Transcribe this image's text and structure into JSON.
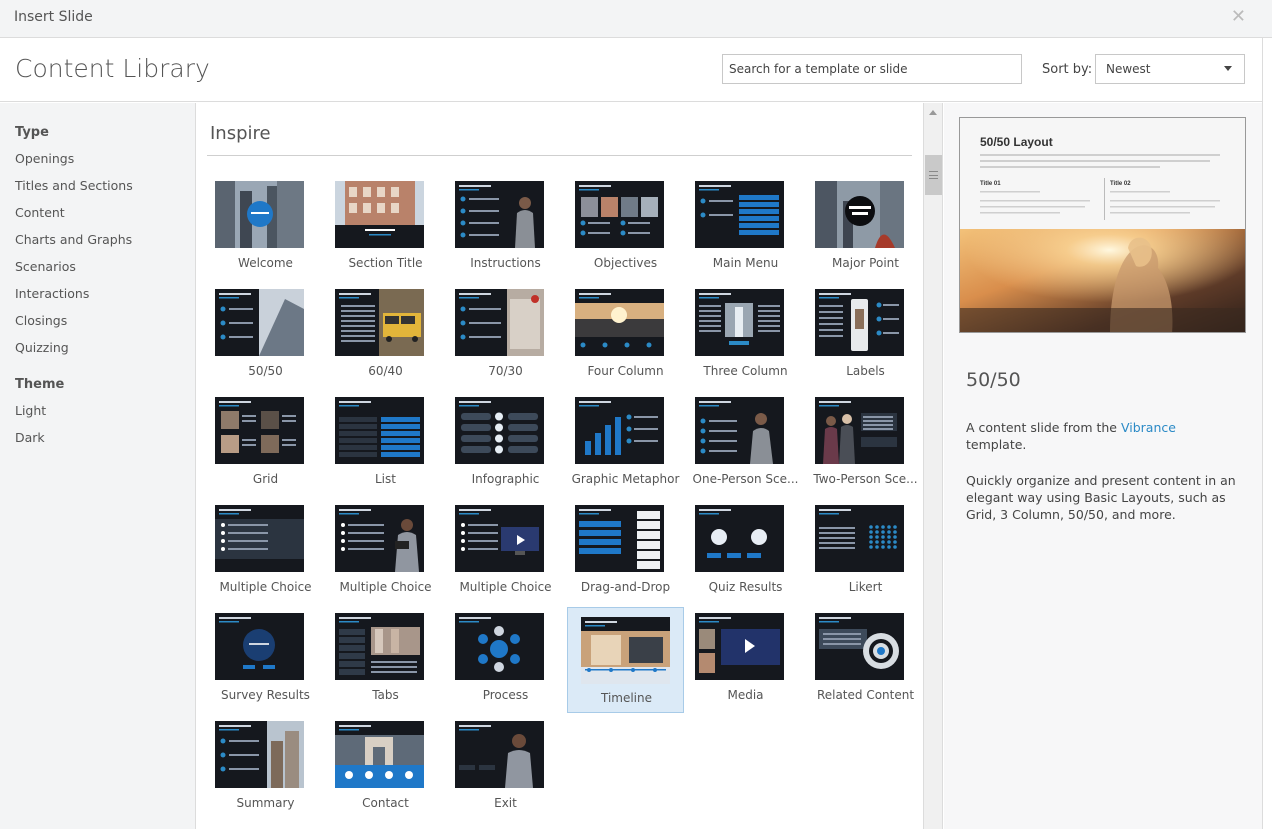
{
  "window": {
    "title": "Insert Slide"
  },
  "header": {
    "title": "Content Library",
    "search_placeholder": "Search for a template or slide",
    "sort_label": "Sort by:",
    "sort_value": "Newest"
  },
  "sidebar": {
    "type_heading": "Type",
    "types": [
      "Openings",
      "Titles and Sections",
      "Content",
      "Charts and Graphs",
      "Scenarios",
      "Interactions",
      "Closings",
      "Quizzing"
    ],
    "theme_heading": "Theme",
    "themes": [
      "Light",
      "Dark"
    ]
  },
  "main": {
    "section_title": "Inspire",
    "tiles": [
      {
        "label": "Welcome",
        "img": "welcome"
      },
      {
        "label": "Section Title",
        "img": "section"
      },
      {
        "label": "Instructions",
        "img": "instructions"
      },
      {
        "label": "Objectives",
        "img": "objectives"
      },
      {
        "label": "Main Menu",
        "img": "menu"
      },
      {
        "label": "Major Point",
        "img": "major"
      },
      {
        "label": "50/50",
        "img": "fifty"
      },
      {
        "label": "60/40",
        "img": "sixty"
      },
      {
        "label": "70/30",
        "img": "seventy"
      },
      {
        "label": "Four Column",
        "img": "four"
      },
      {
        "label": "Three Column",
        "img": "three"
      },
      {
        "label": "Labels",
        "img": "labels"
      },
      {
        "label": "Grid",
        "img": "grid"
      },
      {
        "label": "List",
        "img": "list"
      },
      {
        "label": "Infographic",
        "img": "info"
      },
      {
        "label": "Graphic Metaphor",
        "img": "metaphor"
      },
      {
        "label": "One-Person  Sce...",
        "img": "oneperson"
      },
      {
        "label": "Two-Person  Sce...",
        "img": "twoperson"
      },
      {
        "label": "Multiple Choice",
        "img": "mc1"
      },
      {
        "label": "Multiple Choice",
        "img": "mc2"
      },
      {
        "label": "Multiple Choice",
        "img": "mc3"
      },
      {
        "label": "Drag-and-Drop",
        "img": "drag"
      },
      {
        "label": "Quiz Results",
        "img": "quiz"
      },
      {
        "label": "Likert",
        "img": "likert"
      },
      {
        "label": "Survey Results",
        "img": "survey"
      },
      {
        "label": "Tabs",
        "img": "tabs"
      },
      {
        "label": "Process",
        "img": "process"
      },
      {
        "label": "Timeline",
        "img": "timeline",
        "selected": true
      },
      {
        "label": "Media",
        "img": "media"
      },
      {
        "label": "Related Content",
        "img": "related"
      },
      {
        "label": "Summary",
        "img": "summary"
      },
      {
        "label": "Contact",
        "img": "contact"
      },
      {
        "label": "Exit",
        "img": "exit"
      }
    ]
  },
  "preview": {
    "slide_title": "50/50 Layout",
    "slide_col1": "Title 01",
    "slide_col2": "Title 02",
    "name": "50/50",
    "desc_prefix": "A content slide from the ",
    "desc_link": "Vibrance",
    "desc_suffix": " template.",
    "long_desc": "Quickly organize and present content in an elegant way using Basic Layouts, such as Grid, 3 Column, 50/50, and more."
  },
  "colors": {
    "accent": "#2b8ac6",
    "selection": "#dbeaf7",
    "slide_dark": "#15181e"
  }
}
